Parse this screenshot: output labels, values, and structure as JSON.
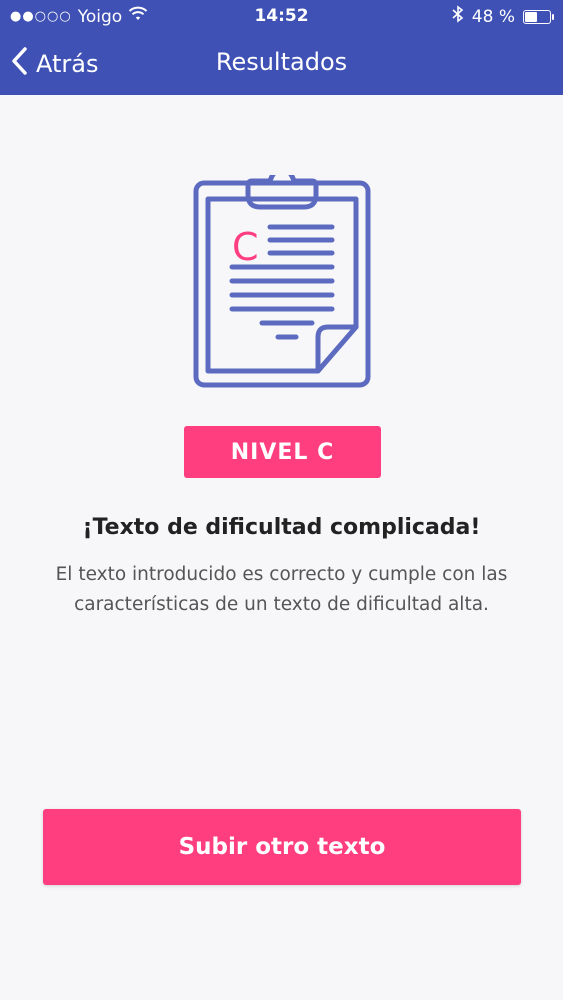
{
  "status_bar": {
    "signal_dots": "●●○○○",
    "carrier": "Yoigo",
    "time": "14:52",
    "battery_percent": "48 %",
    "battery_level": 0.48
  },
  "nav": {
    "back_label": "Atrás",
    "title": "Resultados"
  },
  "result": {
    "icon_letter": "C",
    "level_badge": "NIVEL C",
    "headline": "¡Texto de dificultad complicada!",
    "description": "El texto introducido es correcto y cumple con las características de un texto de dificultad alta."
  },
  "actions": {
    "upload_label": "Subir otro texto"
  },
  "colors": {
    "header": "#3f51b5",
    "accent": "#ff3e7f",
    "icon_stroke": "#5c6bc0"
  }
}
